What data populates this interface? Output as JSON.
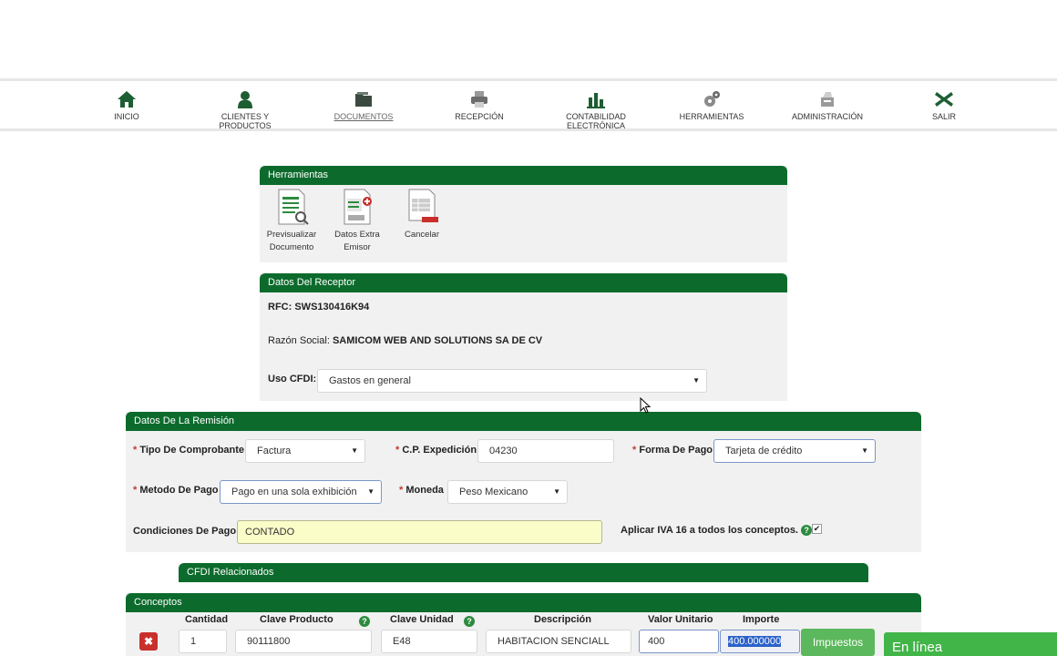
{
  "nav": {
    "items": [
      {
        "label": "INICIO",
        "icon": "home-icon"
      },
      {
        "label": "CLIENTES Y PRODUCTOS",
        "icon": "user-icon"
      },
      {
        "label": "DOCUMENTOS",
        "icon": "folder-icon"
      },
      {
        "label": "RECEPCIÓN",
        "icon": "printer-icon"
      },
      {
        "label": "CONTABILIDAD ELECTRÓNICA",
        "icon": "bar-chart-icon"
      },
      {
        "label": "HERRAMIENTAS",
        "icon": "gears-icon"
      },
      {
        "label": "ADMINISTRACIÓN",
        "icon": "admin-icon"
      },
      {
        "label": "SALIR",
        "icon": "close-x-icon"
      }
    ],
    "active": "DOCUMENTOS"
  },
  "herramientas": {
    "title": "Herramientas",
    "tools": [
      {
        "line1": "Previsualizar",
        "line2": "Documento"
      },
      {
        "line1": "Datos Extra",
        "line2": "Emisor"
      },
      {
        "line1": "Cancelar",
        "line2": ""
      }
    ]
  },
  "receptor": {
    "title": "Datos Del Receptor",
    "rfc_label": "RFC:",
    "rfc_value": "SWS130416K94",
    "razon_label": "Razón Social:",
    "razon_value": "SAMICOM WEB AND SOLUTIONS SA DE CV",
    "uso_label": "Uso CFDI:",
    "uso_value": "Gastos en general"
  },
  "remision": {
    "title": "Datos De La Remisión",
    "tipo_label": "Tipo De Comprobante",
    "tipo_value": "Factura",
    "cp_label": "C.P. Expedición",
    "cp_value": "04230",
    "forma_label": "Forma De Pago",
    "forma_value": "Tarjeta de crédito",
    "metodo_label": "Metodo De Pago",
    "metodo_value": "Pago en una sola exhibición",
    "moneda_label": "Moneda",
    "moneda_value": "Peso Mexicano",
    "condiciones_label": "Condiciones De Pago",
    "condiciones_value": "CONTADO",
    "iva_label": "Aplicar IVA 16 a todos los conceptos.",
    "required_mark": "*"
  },
  "cfdi": {
    "title": "CFDI Relacionados"
  },
  "conceptos": {
    "title": "Conceptos",
    "headers": [
      "Cantidad",
      "Clave Producto",
      "Clave Unidad",
      "Descripción",
      "Valor Unitario",
      "Importe"
    ],
    "row": {
      "cantidad": "1",
      "clave_producto": "90111800",
      "clave_unidad": "E48",
      "descripcion": "HABITACION SENCIALL",
      "valor_unitario": "400",
      "importe": "400.000000"
    },
    "impuestos_label": "Impuestos",
    "help_glyph": "?",
    "delete_glyph": "✖"
  },
  "chat": {
    "label": "En línea"
  }
}
